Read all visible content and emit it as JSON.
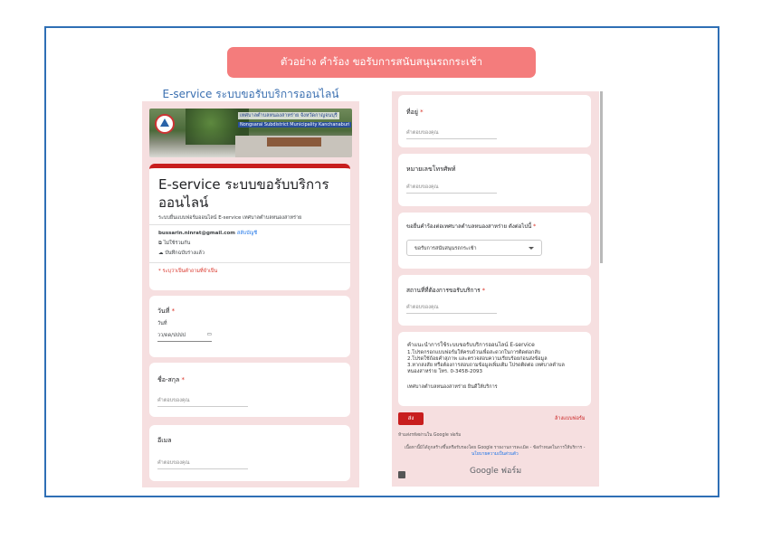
{
  "banner": "ตัวอย่าง คำร้อง ขอรับการสนับสนุนรถกระเช้า",
  "left": {
    "page_title": "E-service ระบบขอรับบริการออนไลน์",
    "header_line1": "เทศบาลตำบลหนองสาหร่าย จังหวัดกาญจนบุรี",
    "header_line2": "Nongsarai Subdistrict Municipality Kanchanaburi",
    "form_title": "E-service ระบบขอรับบริการออนไลน์",
    "form_desc": "ระบบยื่นแบบฟอร์มออนไลน์ E-service เทศบาลตำบลหนองสาหร่าย",
    "email": "bussarin.ninrat@gmail.com",
    "switch_account": "สลับบัญชี",
    "not_shared": "ไม่ใช้ร่วมกัน",
    "draft_saved": "บันทึกฉบับร่างแล้ว",
    "required_note": "* ระบุว่าเป็นคำถามที่จำเป็น",
    "date_label": "วันที่",
    "date_sub": "วันที่",
    "date_placeholder": "วว/ดด/ปปปป",
    "name_label": "ชื่อ-สกุล",
    "name_placeholder": "คำตอบของคุณ",
    "email_label": "อีเมล",
    "email_placeholder": "คำตอบของคุณ"
  },
  "right": {
    "address_label": "ที่อยู่",
    "address_placeholder": "คำตอบของคุณ",
    "phone_label": "หมายเลขโทรศัพท์",
    "phone_placeholder": "คำตอบของคุณ",
    "request_label": "ขอยื่นคำร้องต่อเทศบาลตำบลหนองสาหร่าย ดังต่อไปนี้",
    "request_value": "ขอรับการสนับสนุนรถกระเช้า",
    "location_label": "สถานที่ที่ต้องการขอรับบริการ",
    "location_placeholder": "คำตอบของคุณ",
    "guide_title": "คำแนะนำการใช้ระบบขอรับบริการออนไลน์ E-service",
    "guide_lines": [
      "1.โปรดกรอกแบบฟอร์มให้ครบถ้วนเพื่อสะดวกในการติดต่อกลับ",
      "2.โปรดใช้ถ้อยคำสุภาพ และตรวจสอบความเรียบร้อยก่อนส่งข้อมูล",
      "3.หากสงสัย หรือต้องการสอบถามข้อมูลเพิ่มเติม โปรดติดต่อ เทศบาลตำบล",
      "หนองสาหร่าย โทร. 0-3458-2093"
    ],
    "guide_footer": "เทศบาลตำบลหนองสาหร่าย ยินดีให้บริการ",
    "submit": "ส่ง",
    "clear": "ล้างแบบฟอร์ม",
    "never_password": "ห้ามส่งรหัสผ่านใน Google ฟอร์ม",
    "footer_line1": "เนื้อหานี้มิได้ถูกสร้างขึ้นหรือรับรองโดย Google รายงานการละเมิด - ข้อกำหนดในการให้บริการ -",
    "footer_line2": "นโยบายความเป็นส่วนตัว",
    "google_forms": "Google ฟอร์ม"
  }
}
